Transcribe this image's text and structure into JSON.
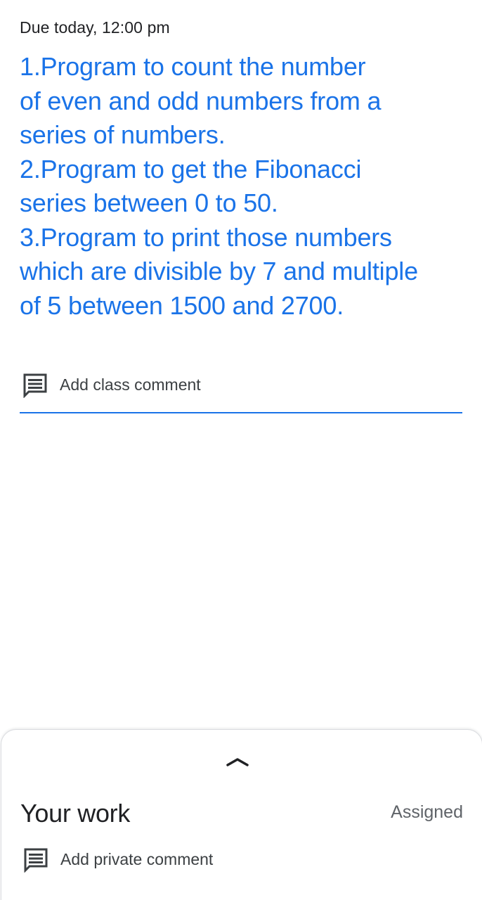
{
  "due_text": "Due today, 12:00 pm",
  "assignment_lines": [
    "1.Program to count the number",
    "of even and odd numbers from a",
    "series of numbers.",
    "2.Program to get the Fibonacci",
    "series between 0 to 50.",
    "3.Program to print those numbers",
    "which are divisible by 7 and multiple",
    "of 5 between 1500 and 2700."
  ],
  "class_comment": {
    "label": "Add class comment",
    "icon": "comment-icon"
  },
  "your_work": {
    "handle_icon": "chevron-up-icon",
    "title": "Your work",
    "status": "Assigned",
    "private_comment_label": "Add private comment",
    "private_comment_icon": "comment-icon"
  },
  "colors": {
    "accent": "#1a73e8",
    "text_primary": "#202124",
    "text_secondary": "#5f6368",
    "icon": "#3c4043"
  }
}
